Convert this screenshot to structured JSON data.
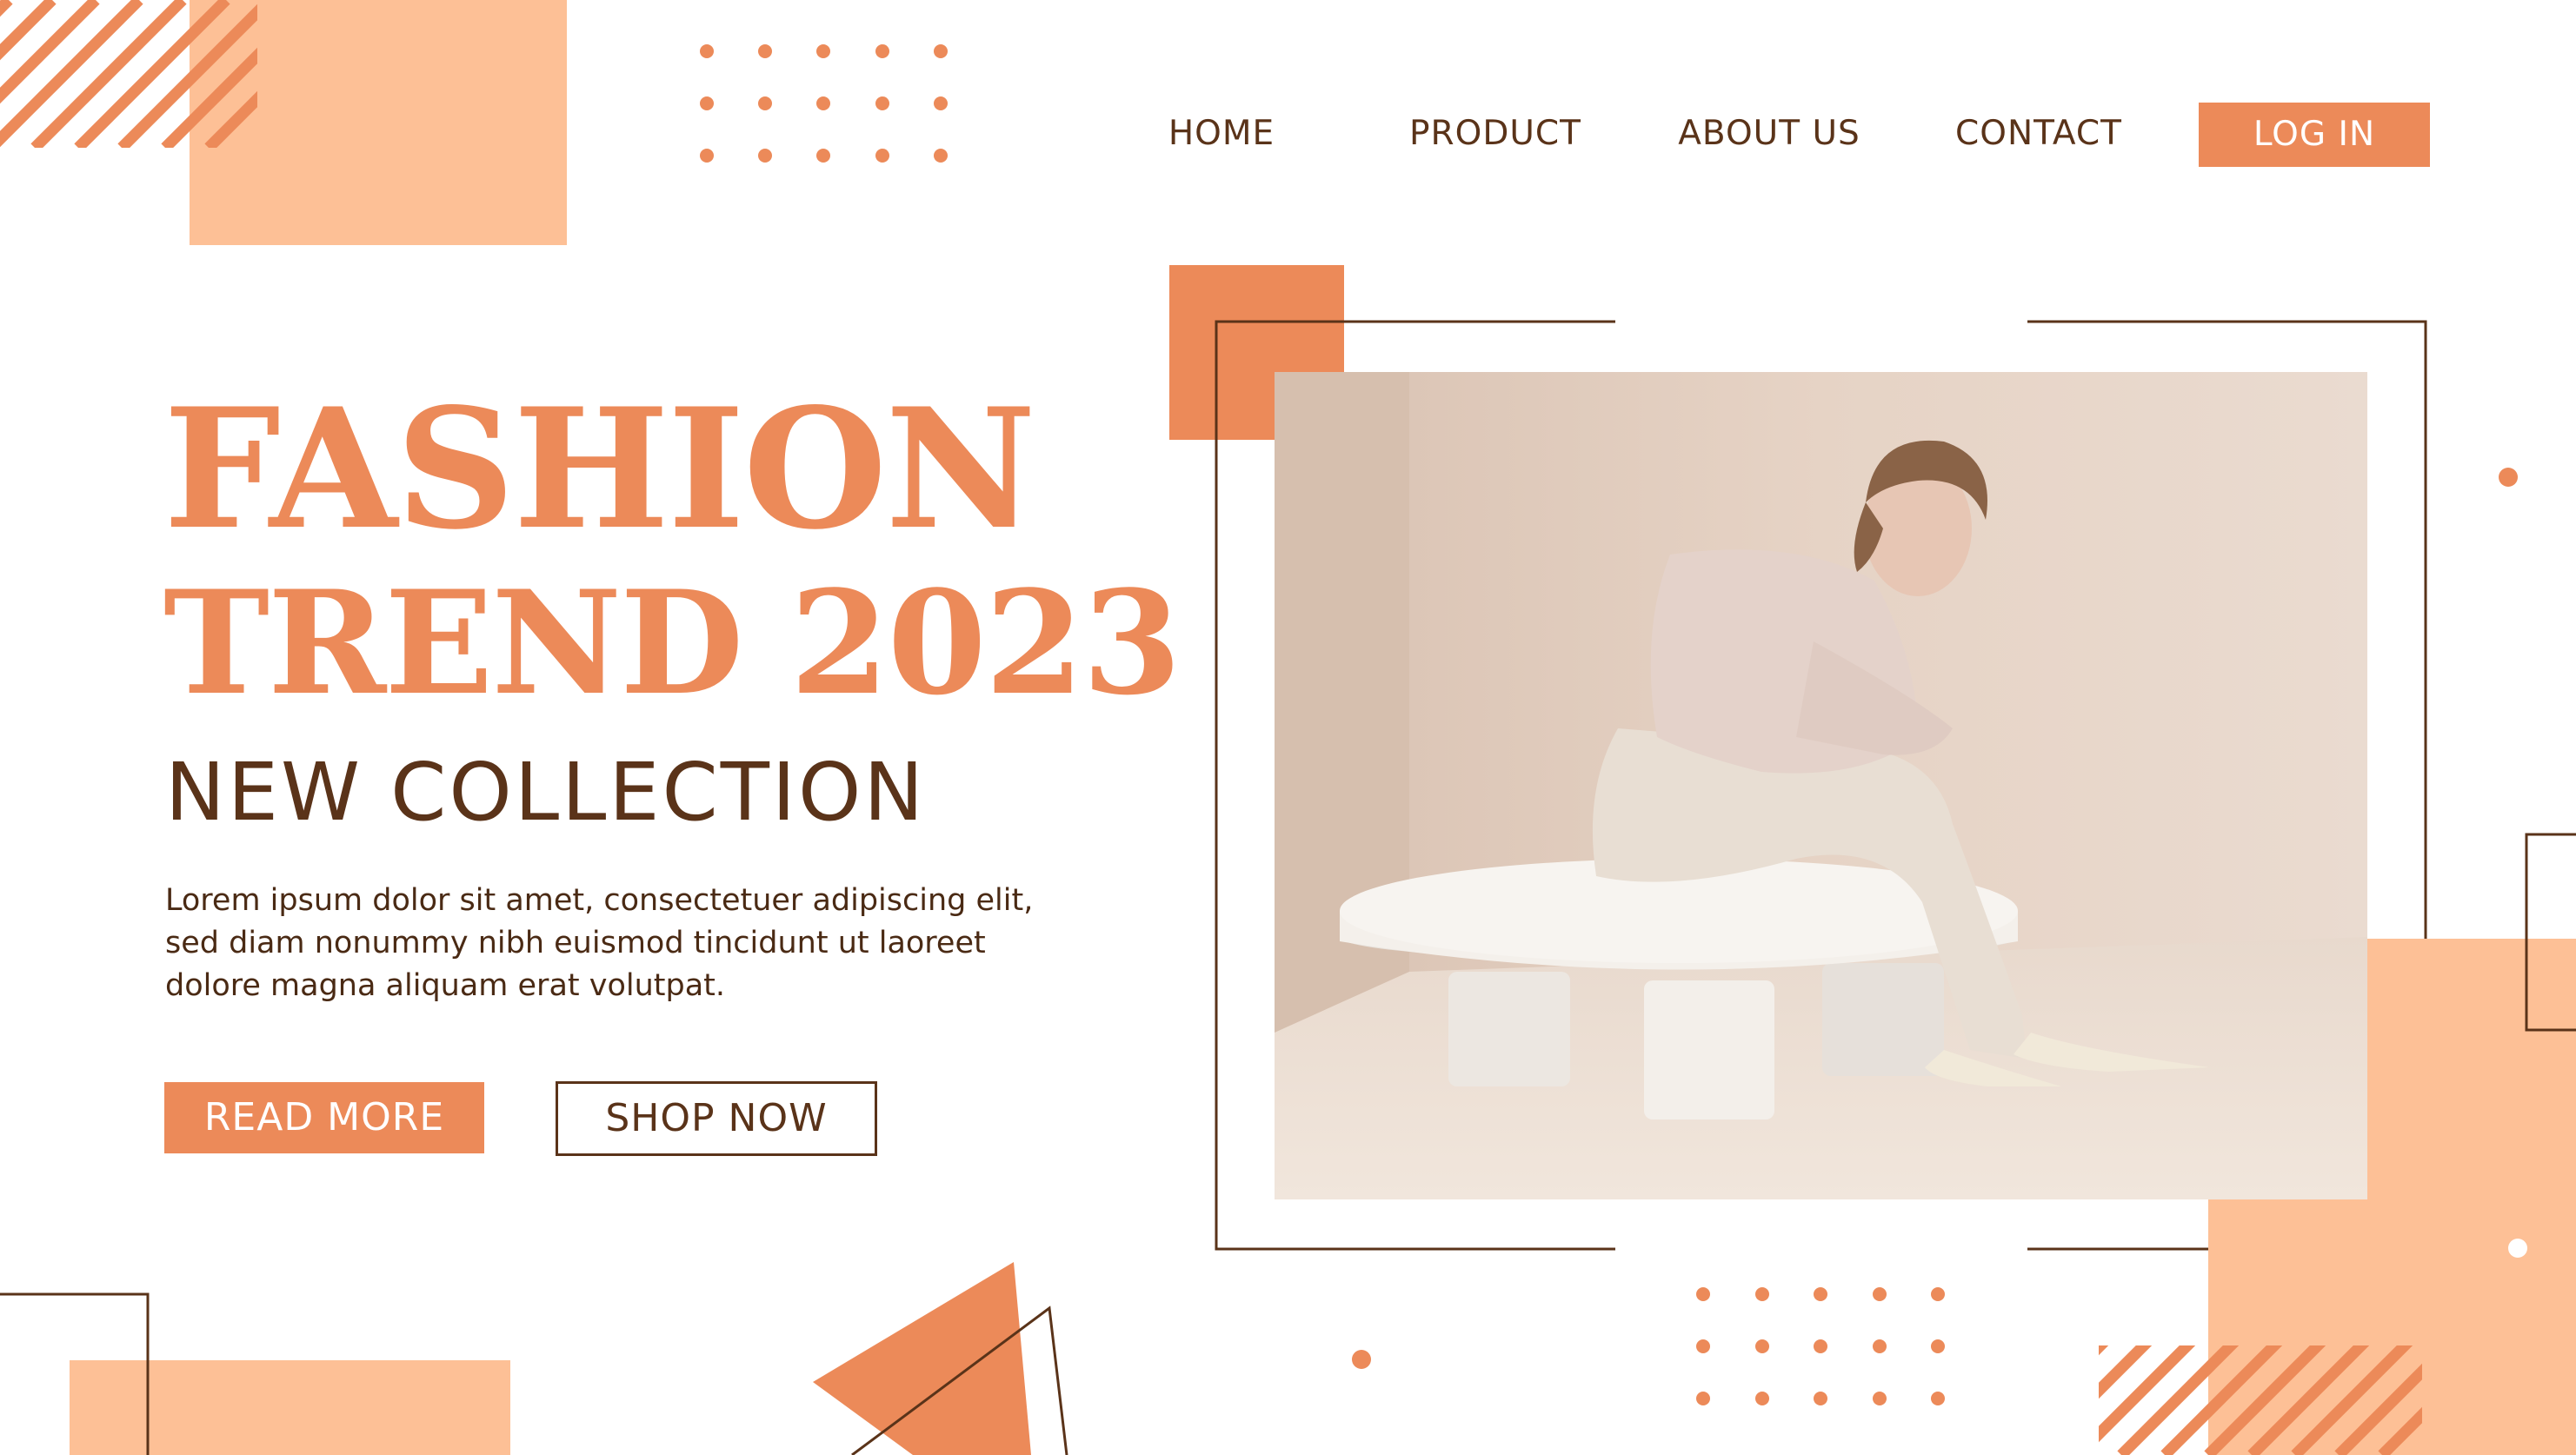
{
  "nav": {
    "home": "HOME",
    "product": "PRODUCT",
    "about": "ABOUT US",
    "contact": "CONTACT",
    "login": "LOG IN"
  },
  "hero": {
    "title_line1": "FASHION",
    "title_line2": "TREND 2023",
    "subtitle": "NEW COLLECTION",
    "body_line1": "Lorem ipsum dolor sit amet, consectetuer adipiscing elit,",
    "body_line2": "sed diam nonummy nibh euismod tincidunt ut laoreet",
    "body_line3": "dolore magna aliquam erat volutpat.",
    "read_more": "READ MORE",
    "shop_now": "SHOP NOW"
  },
  "colors": {
    "accent": "#ec8a59",
    "accent_light": "#fdc096",
    "dark_brown": "#5a3319",
    "photo_background": "#e2cfc1"
  },
  "icons": {
    "photo": "fashion-model-photo"
  }
}
